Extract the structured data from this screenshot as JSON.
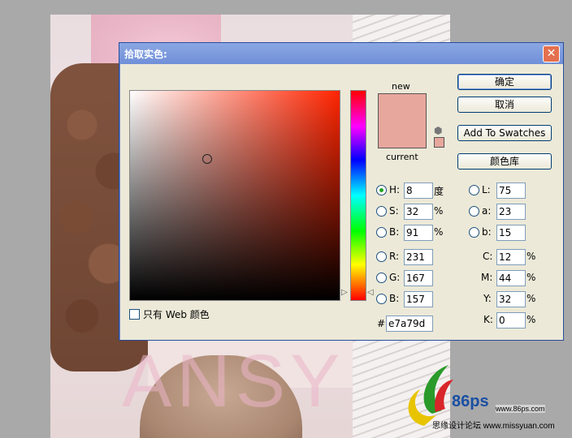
{
  "dialog": {
    "title": "拾取实色:",
    "close_glyph": "✕",
    "swatch_new_label": "new",
    "swatch_current_label": "current",
    "current_color": "#e7a79d",
    "buttons": {
      "ok": "确定",
      "cancel": "取消",
      "add_swatches": "Add To Swatches",
      "color_libraries": "颜色库"
    },
    "web_only_label": "只有 Web 颜色",
    "hsb": {
      "h": {
        "label": "H:",
        "value": "8",
        "unit": "度"
      },
      "s": {
        "label": "S:",
        "value": "32",
        "unit": "%"
      },
      "b": {
        "label": "B:",
        "value": "91",
        "unit": "%"
      }
    },
    "rgb": {
      "r": {
        "label": "R:",
        "value": "231"
      },
      "g": {
        "label": "G:",
        "value": "167"
      },
      "b": {
        "label": "B:",
        "value": "157"
      }
    },
    "hex": {
      "label": "#",
      "value": "e7a79d"
    },
    "lab": {
      "l": {
        "label": "L:",
        "value": "75"
      },
      "a": {
        "label": "a:",
        "value": "23"
      },
      "b": {
        "label": "b:",
        "value": "15"
      }
    },
    "cmyk": {
      "c": {
        "label": "C:",
        "value": "12",
        "unit": "%"
      },
      "m": {
        "label": "M:",
        "value": "44",
        "unit": "%"
      },
      "y": {
        "label": "Y:",
        "value": "32",
        "unit": "%"
      },
      "k": {
        "label": "K:",
        "value": "0",
        "unit": "%"
      }
    }
  },
  "background": {
    "watermark_text": "ANSY",
    "logo_number": "86ps",
    "logo_url": "www.86ps.com",
    "logo_subtitle": "思缘设计论坛  www.missyuan.com"
  }
}
